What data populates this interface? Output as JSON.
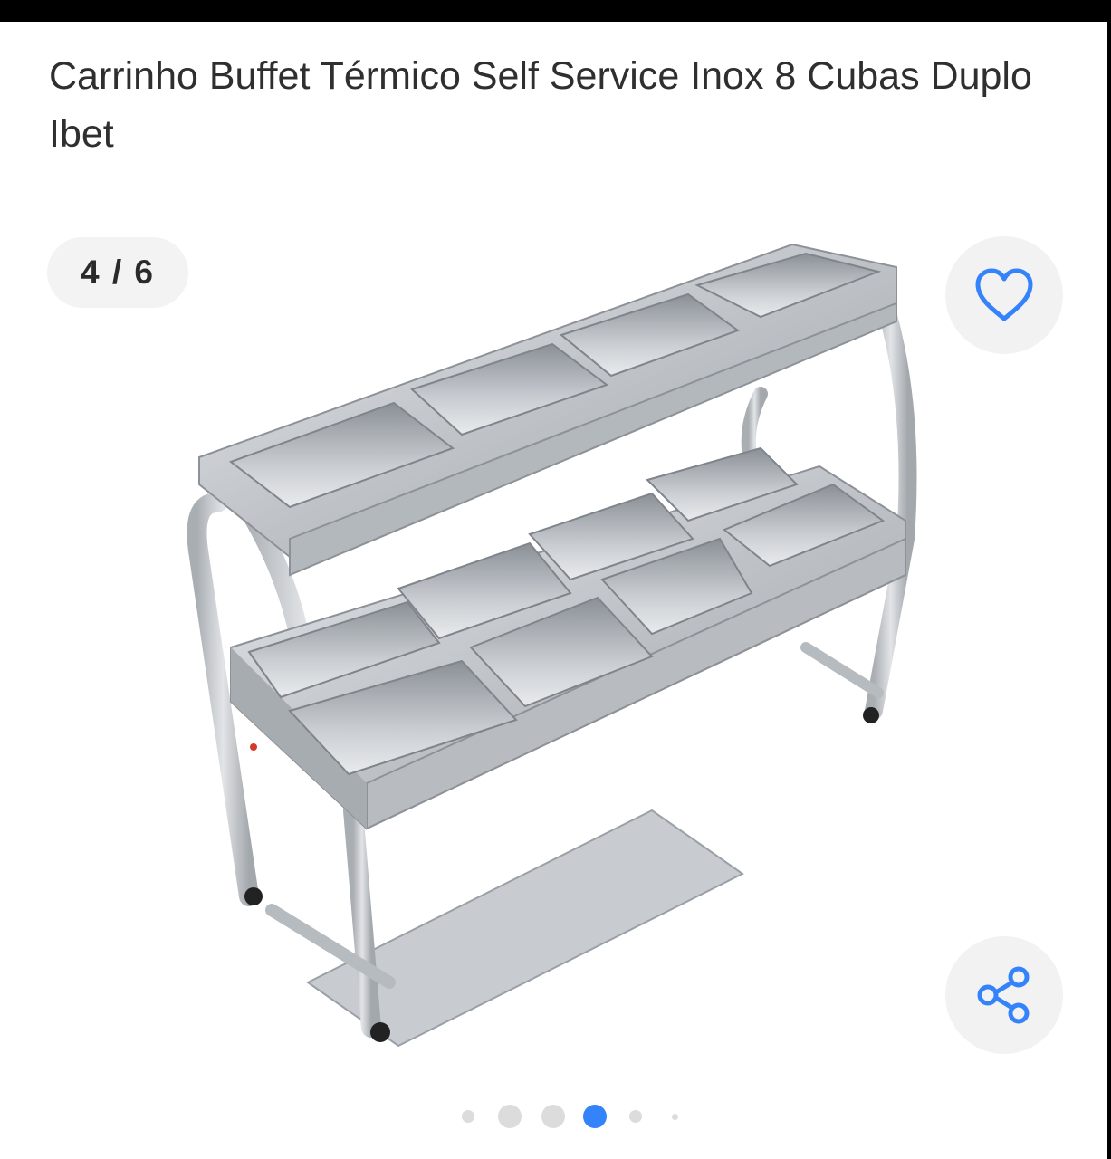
{
  "product": {
    "title": "Carrinho Buffet Térmico Self Service Inox 8 Cubas Duplo Ibet"
  },
  "gallery": {
    "counter": "4 / 6",
    "current": 4,
    "total": 6,
    "image_alt": "Carrinho buffet inox com 8 cubas em dois níveis"
  },
  "actions": {
    "favorite_icon": "heart-outline-icon",
    "share_icon": "share-icon"
  },
  "colors": {
    "accent": "#3483fa",
    "button_bg": "#f2f2f2"
  }
}
